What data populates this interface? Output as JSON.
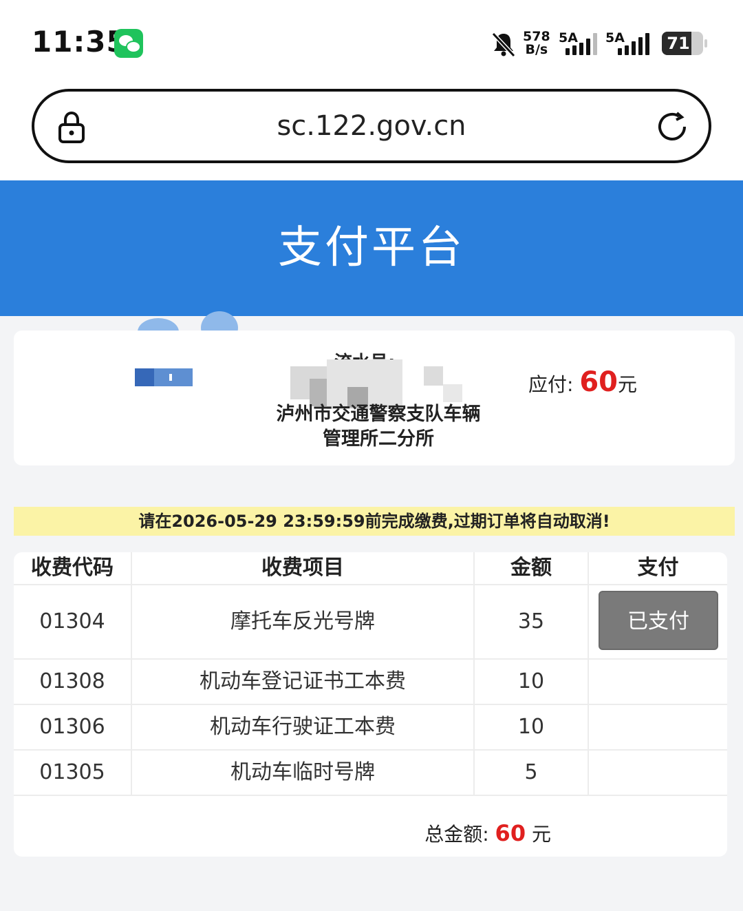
{
  "status_bar": {
    "time": "11:35",
    "net_speed_value": "578",
    "net_speed_unit": "B/s",
    "sim1_label": "5A",
    "sim2_label": "5A",
    "battery_level": "71",
    "battery_fraction": 0.71
  },
  "browser": {
    "url": "sc.122.gov.cn"
  },
  "header": {
    "title": "支付平台"
  },
  "order_info": {
    "serial_label": "流水号:",
    "organization": "泸州市交通警察支队车辆管理所二分所",
    "payable_label": "应付:",
    "payable_amount": "60",
    "payable_unit": "元"
  },
  "notice": {
    "text": "请在2026-05-29 23:59:59前完成缴费,过期订单将自动取消!"
  },
  "fee_table": {
    "headers": [
      "收费代码",
      "收费项目",
      "金额",
      "支付"
    ],
    "rows": [
      {
        "code": "01304",
        "item": "摩托车反光号牌",
        "amount": "35",
        "pay": "已支付"
      },
      {
        "code": "01308",
        "item": "机动车登记证书工本费",
        "amount": "10",
        "pay": ""
      },
      {
        "code": "01306",
        "item": "机动车行驶证工本费",
        "amount": "10",
        "pay": ""
      },
      {
        "code": "01305",
        "item": "机动车临时号牌",
        "amount": "5",
        "pay": ""
      }
    ],
    "total_label": "总金额:",
    "total_amount": "60",
    "total_unit": "元"
  },
  "colors": {
    "header_blue": "#2b7fdb",
    "amount_red": "#e0201f",
    "notice_yellow": "#fbf3a6",
    "paid_button_gray": "#7a7a7a"
  }
}
